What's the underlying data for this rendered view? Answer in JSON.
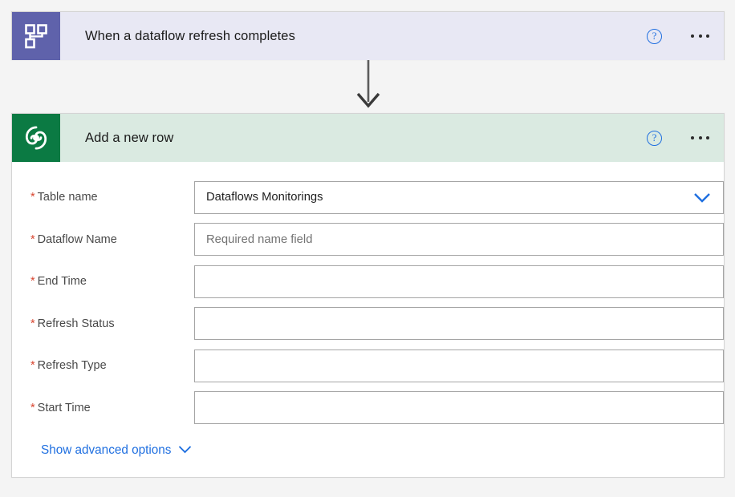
{
  "theme": {
    "page_background": "#f4f4f4",
    "trigger_accent": "#5f62ab",
    "trigger_header_background": "#e8e8f4",
    "action_accent": "#0b7a43",
    "action_header_background": "#daeae1",
    "link_blue": "#1f6fe0",
    "required_red": "#d8452f",
    "card_border": "#d4d4d4",
    "input_border": "#a5a5a5"
  },
  "trigger": {
    "title": "When a dataflow refresh completes",
    "icon": "dataflow-hierarchy-icon",
    "help_label": "?",
    "more_label": "..."
  },
  "connector": {
    "icon": "arrow-down-icon"
  },
  "action": {
    "title": "Add a new row",
    "icon": "dataverse-swirl-icon",
    "help_label": "?",
    "more_label": "...",
    "fields": [
      {
        "name": "table-name",
        "label": "Table name",
        "required": true,
        "required_marker": "*",
        "value": "Dataflows Monitorings",
        "placeholder": "",
        "control": "dropdown",
        "dropdown_icon": "chevron-down-icon"
      },
      {
        "name": "dataflow-name",
        "label": "Dataflow Name",
        "required": true,
        "required_marker": "*",
        "value": "",
        "placeholder": "Required name field",
        "control": "text"
      },
      {
        "name": "end-time",
        "label": "End Time",
        "required": true,
        "required_marker": "*",
        "value": "",
        "placeholder": "",
        "control": "text"
      },
      {
        "name": "refresh-status",
        "label": "Refresh Status",
        "required": true,
        "required_marker": "*",
        "value": "",
        "placeholder": "",
        "control": "text"
      },
      {
        "name": "refresh-type",
        "label": "Refresh Type",
        "required": true,
        "required_marker": "*",
        "value": "",
        "placeholder": "",
        "control": "text"
      },
      {
        "name": "start-time",
        "label": "Start Time",
        "required": true,
        "required_marker": "*",
        "value": "",
        "placeholder": "",
        "control": "text"
      }
    ],
    "advanced_options": {
      "label": "Show advanced options",
      "icon": "chevron-down-icon"
    }
  }
}
